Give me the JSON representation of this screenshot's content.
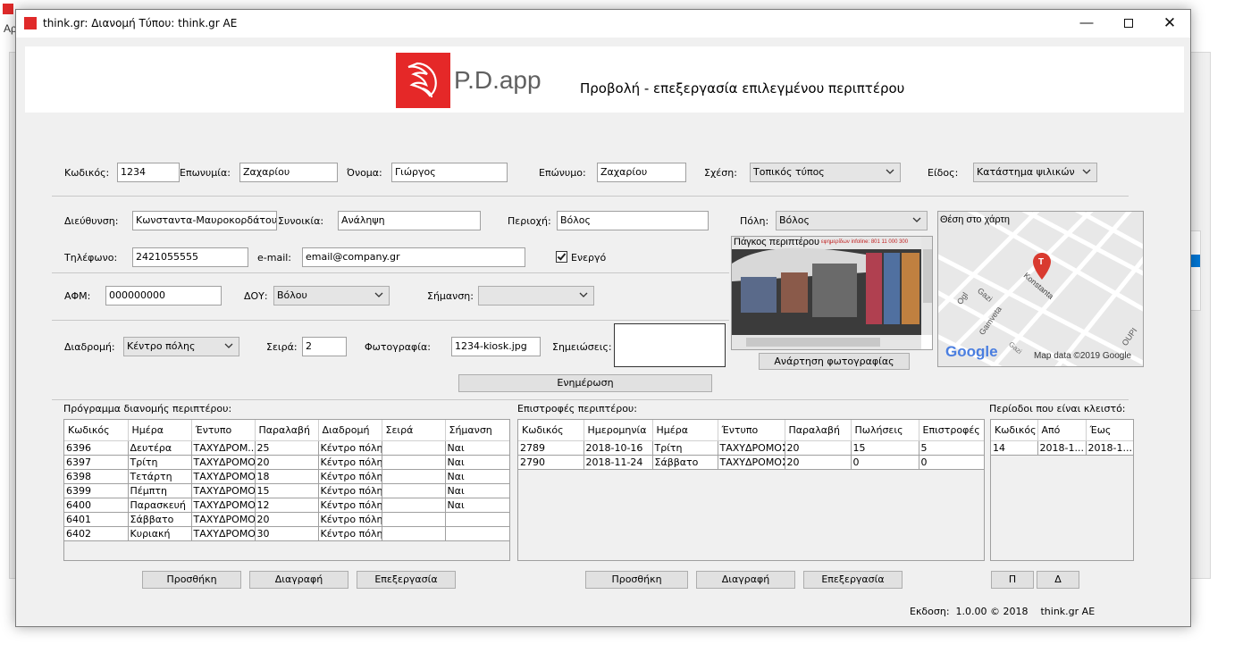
{
  "window": {
    "title": "think.gr: Διανομή Τύπου: think.gr AE"
  },
  "header": {
    "logo_text": "P.D.app",
    "title": "Προβολή - επεξεργασία επιλεγμένου περιπτέρου"
  },
  "form": {
    "code_label": "Κωδικός:",
    "code_value": "1234",
    "brand_label": "Επωνυμία:",
    "brand_value": "Ζαχαρίου",
    "name_label": "Όνομα:",
    "name_value": "Γιώργος",
    "surname_label": "Επώνυμο:",
    "surname_value": "Ζαχαρίου",
    "relation_label": "Σχέση:",
    "relation_value": "Τοπικός τύπος",
    "type_label": "Είδος:",
    "type_value": "Κατάστημα ψιλικών",
    "address_label": "Διεύθυνση:",
    "address_value": "Κωνσταντα-Μαυροκορδάτου",
    "neighborhood_label": "Συνοικία:",
    "neighborhood_value": "Ανάληψη",
    "area_label": "Περιοχή:",
    "area_value": "Βόλος",
    "city_label": "Πόλη:",
    "city_value": "Βόλος",
    "phone_label": "Τηλέφωνο:",
    "phone_value": "2421055555",
    "email_label": "e-mail:",
    "email_value": "email@company.gr",
    "active_label": "Ενεργό",
    "afm_label": "ΑΦΜ:",
    "afm_value": "000000000",
    "doy_label": "ΔΟΥ:",
    "doy_value": "Βόλου",
    "marking_label": "Σήμανση:",
    "marking_value": "",
    "route_label": "Διαδρομή:",
    "route_value": "Κέντρο πόλης",
    "order_label": "Σειρά:",
    "order_value": "2",
    "photo_label": "Φωτογραφία:",
    "photo_value": "1234-kiosk.jpg",
    "notes_label": "Σημειώσεις:",
    "update_button": "Ενημέρωση"
  },
  "photo_panel": {
    "caption": "Πάγκος περιπτέρου",
    "sign_text": "εφημερίδων infoline: 801 11 000 300",
    "upload_button": "Ανάρτηση φωτογραφίας"
  },
  "map_panel": {
    "caption": "Θέση στο χάρτη",
    "pin_letter": "T",
    "street_labels": [
      "Ogl",
      "Gazi",
      "Gamveta",
      "Konstanta",
      "OUPI",
      "Gazi"
    ],
    "google": "Google",
    "attribution": "Map data ©2019 Google"
  },
  "schedule": {
    "label": "Πρόγραμμα διανομής περιπτέρου:",
    "columns": [
      "Κωδικός",
      "Ημέρα",
      "Έντυπο",
      "Παραλαβή",
      "Διαδρομή",
      "Σειρά",
      "Σήμανση"
    ],
    "rows": [
      [
        "6396",
        "Δευτέρα",
        "ΤΑΧΥΔΡΟΜ...",
        "25",
        "Κέντρο πόλης",
        "",
        "Ναι"
      ],
      [
        "6397",
        "Τρίτη",
        "ΤΑΧΥΔΡΟΜΟΣ",
        "20",
        "Κέντρο πόλης",
        "",
        "Ναι"
      ],
      [
        "6398",
        "Τετάρτη",
        "ΤΑΧΥΔΡΟΜΟΣ",
        "18",
        "Κέντρο πόλης",
        "",
        "Ναι"
      ],
      [
        "6399",
        "Πέμπτη",
        "ΤΑΧΥΔΡΟΜΟΣ",
        "15",
        "Κέντρο πόλης",
        "",
        "Ναι"
      ],
      [
        "6400",
        "Παρασκευή",
        "ΤΑΧΥΔΡΟΜΟΣ",
        "12",
        "Κέντρο πόλης",
        "",
        "Ναι"
      ],
      [
        "6401",
        "Σάββατο",
        "ΤΑΧΥΔΡΟΜΟΣ",
        "20",
        "Κέντρο πόλης",
        "",
        ""
      ],
      [
        "6402",
        "Κυριακή",
        "ΤΑΧΥΔΡΟΜΟΣ",
        "30",
        "Κέντρο πόλης",
        "",
        ""
      ]
    ],
    "add_button": "Προσθήκη",
    "delete_button": "Διαγραφή",
    "edit_button": "Επεξεργασία"
  },
  "returns": {
    "label": "Επιστροφές περιπτέρου:",
    "columns": [
      "Κωδικός",
      "Ημερομηνία",
      "Ημέρα",
      "Έντυπο",
      "Παραλαβή",
      "Πωλήσεις",
      "Επιστροφές"
    ],
    "rows": [
      [
        "2789",
        "2018-10-16",
        "Τρίτη",
        "ΤΑΧΥΔΡΟΜΟΣ",
        "20",
        "15",
        "5"
      ],
      [
        "2790",
        "2018-11-24",
        "Σάββατο",
        "ΤΑΧΥΔΡΟΜΟΣ",
        "20",
        "0",
        "0"
      ]
    ],
    "add_button": "Προσθήκη",
    "delete_button": "Διαγραφή",
    "edit_button": "Επεξεργασία"
  },
  "closed": {
    "label": "Περίοδοι που είναι κλειστό:",
    "columns": [
      "Κωδικός",
      "Από",
      "Έως"
    ],
    "rows": [
      [
        "14",
        "2018-1...",
        "2018-1..."
      ]
    ],
    "p_button": "Π",
    "d_button": "Δ"
  },
  "footer": {
    "version": "Εκδοση:  1.0.00 © 2018    think.gr AE"
  },
  "background": {
    "ap_text": "Αρ"
  },
  "colors": {
    "brand_red": "#e52828",
    "window_bg": "#f0f0f0",
    "pin_red": "#d93a2f"
  }
}
